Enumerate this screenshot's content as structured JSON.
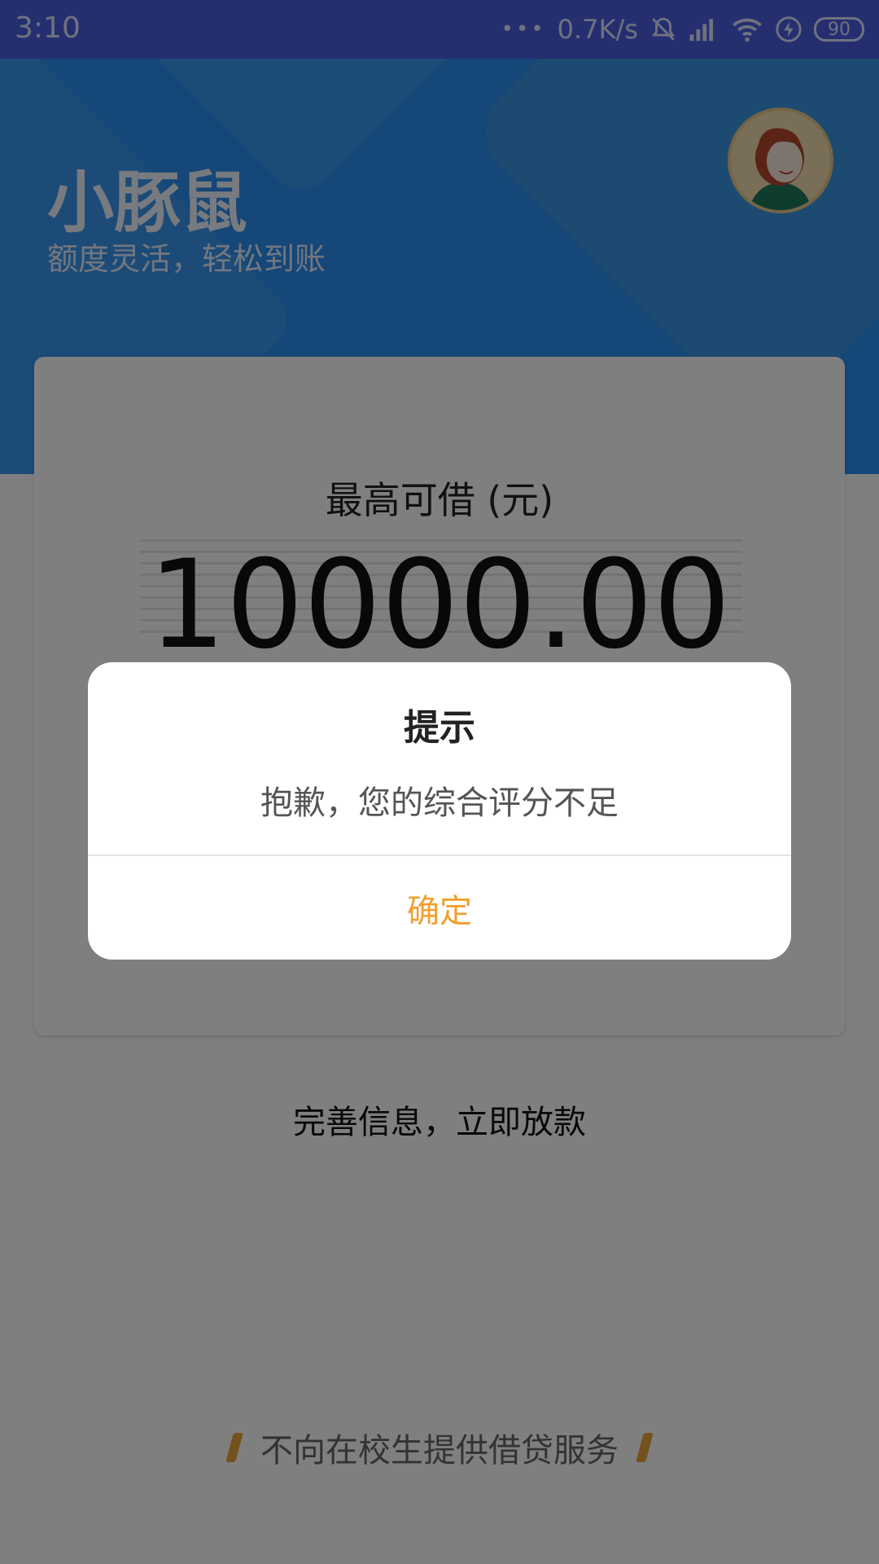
{
  "status_bar": {
    "time": "3:10",
    "network_speed": "0.7K/s",
    "battery": "90",
    "icons": [
      "more-dots-icon",
      "mute-icon",
      "signal-icon",
      "wifi-icon",
      "charging-icon",
      "battery-icon"
    ]
  },
  "header": {
    "title": "小豚鼠",
    "subtitle": "额度灵活，轻松到账",
    "background_color": "#2a8ff0"
  },
  "card": {
    "label": "最高可借 (元)",
    "amount": "10000.00",
    "action_text": "完善信息，立即放款"
  },
  "footer": {
    "notice": "不向在校生提供借贷服务",
    "accent_color": "#e9a23a"
  },
  "dialog": {
    "title": "提示",
    "message": "抱歉，您的综合评分不足",
    "confirm_label": "确定",
    "confirm_color": "#f0a030"
  }
}
